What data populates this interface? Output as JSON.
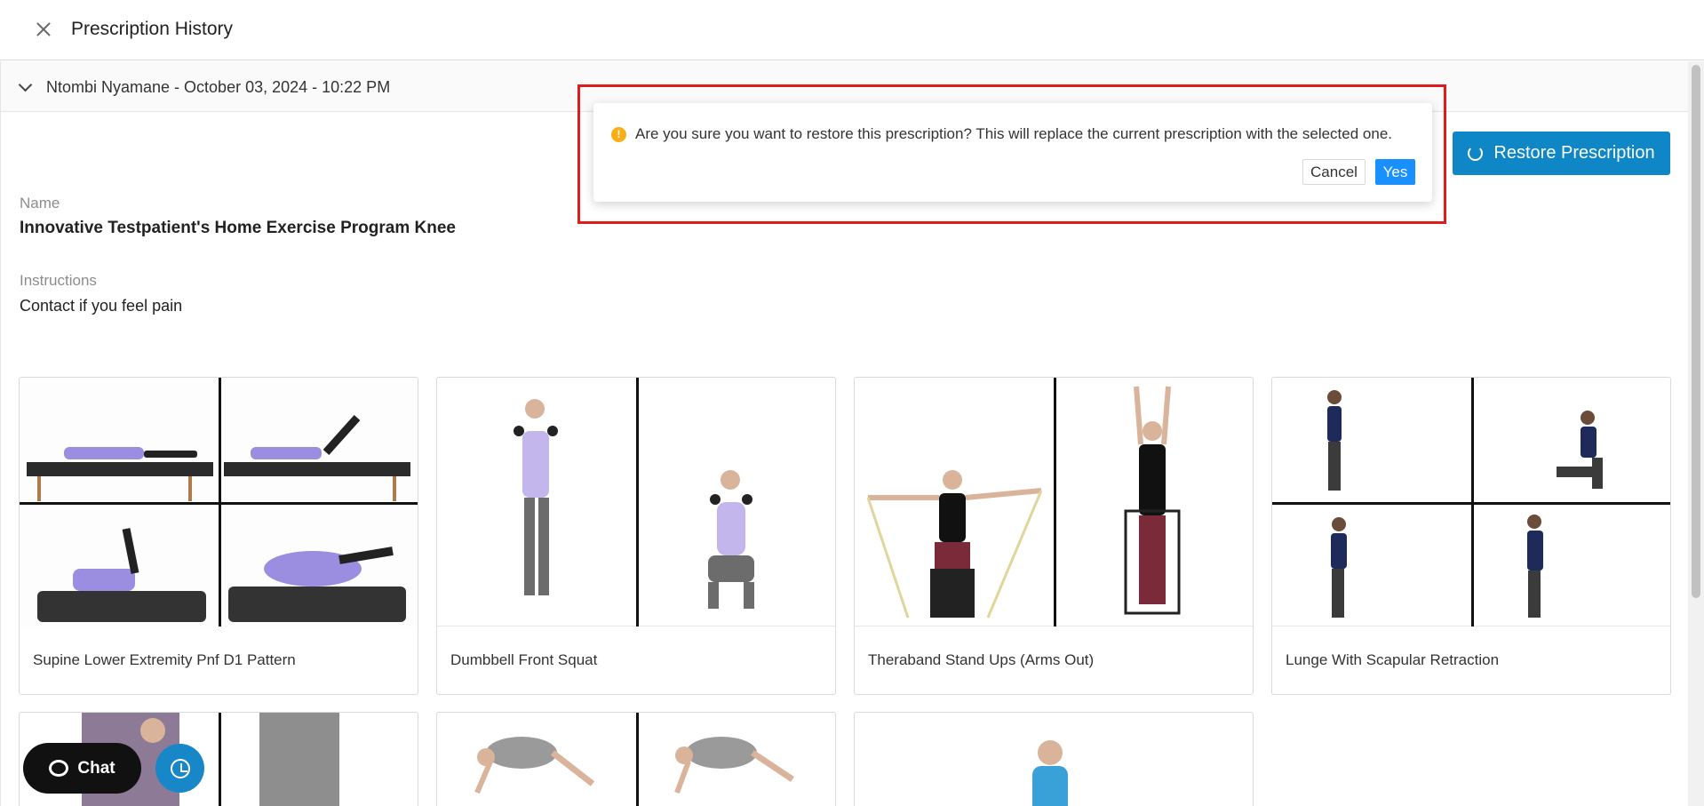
{
  "header": {
    "title": "Prescription History",
    "close_icon": "close-icon"
  },
  "history": {
    "entry_label": "Ntombi Nyamane - October 03, 2024 - 10:22 PM",
    "expand_icon": "chevron-down-icon"
  },
  "restore": {
    "label": "Restore Prescription",
    "icon": "restore-icon",
    "color": "#0f86c6"
  },
  "popconfirm": {
    "message": "Are you sure you want to restore this prescription? This will replace the current prescription with the selected one.",
    "cancel_label": "Cancel",
    "yes_label": "Yes",
    "warning_icon": "exclamation-circle-icon",
    "warning_glyph": "!",
    "highlight_color": "#e01b1b"
  },
  "program": {
    "name_label": "Name",
    "name_value": "Innovative Testpatient's Home Exercise Program Knee",
    "instructions_label": "Instructions",
    "instructions_value": "Contact if you feel pain"
  },
  "exercises": [
    {
      "title": "Supine Lower Extremity Pnf D1 Pattern"
    },
    {
      "title": "Dumbbell Front Squat"
    },
    {
      "title": "Theraband Stand Ups (Arms Out)"
    },
    {
      "title": "Lunge With Scapular Retraction"
    }
  ],
  "floating": {
    "chat_label": "Chat",
    "chat_icon": "chat-bubble-icon",
    "history_icon": "clock-history-icon"
  }
}
